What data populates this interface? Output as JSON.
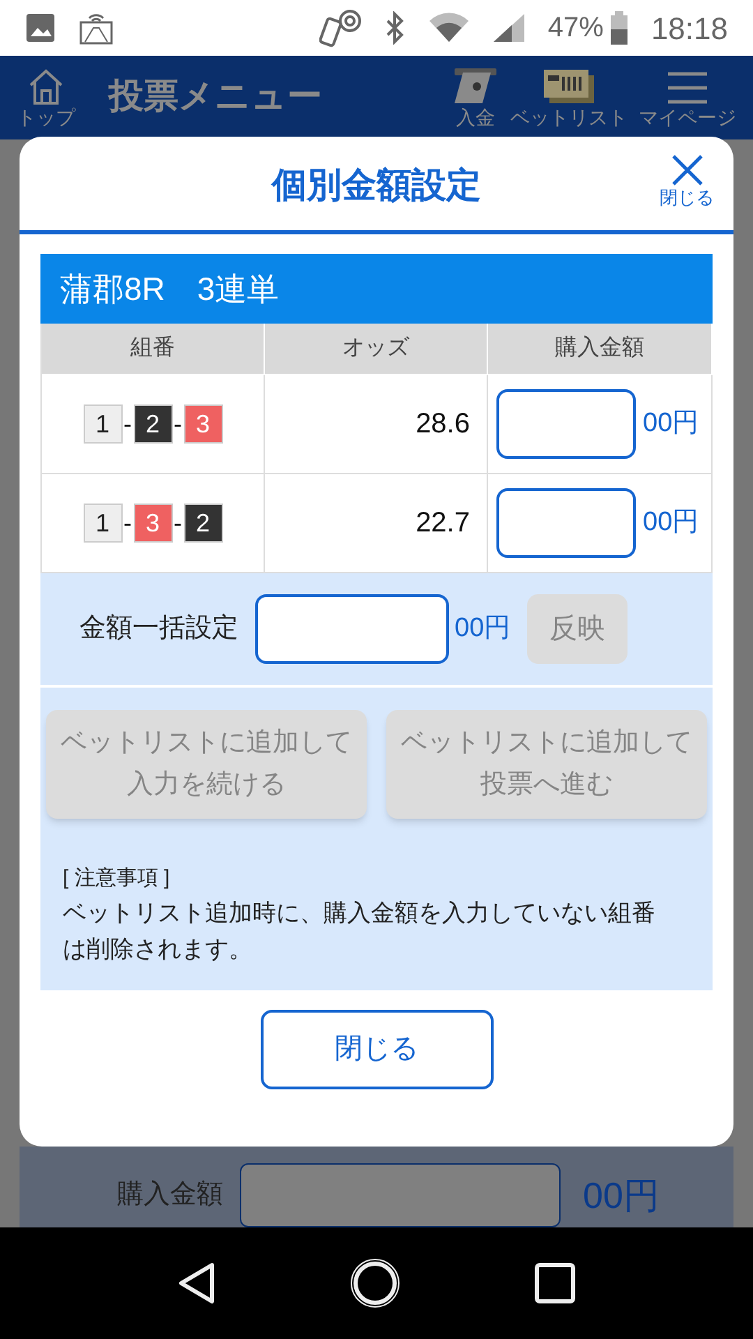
{
  "status_bar": {
    "battery": "47%",
    "time": "18:18"
  },
  "header": {
    "title": "投票メニュー",
    "nav": [
      {
        "kind": "home",
        "label": "トップ"
      },
      {
        "kind": "deposit",
        "label": "入金"
      },
      {
        "kind": "betlist",
        "label": "ベットリスト"
      },
      {
        "kind": "menu",
        "label": "マイページ"
      }
    ]
  },
  "modal": {
    "title": "個別金額設定",
    "close_label": "閉じる",
    "race": "蒲郡8R　3連単",
    "columns": [
      "組番",
      "オッズ",
      "購入金額"
    ],
    "rows": [
      {
        "balls": [
          {
            "number": "1",
            "color": "#eeeeee"
          },
          {
            "number": "2",
            "color": "#333333"
          },
          {
            "number": "3",
            "color": "#ef6161"
          }
        ],
        "separators": [
          "-",
          "-"
        ],
        "odds": "28.6",
        "unit": "00円"
      },
      {
        "balls": [
          {
            "number": "1",
            "color": "#eeeeee"
          },
          {
            "number": "3",
            "color": "#ef6161"
          },
          {
            "number": "2",
            "color": "#333333"
          }
        ],
        "separators": [
          "-",
          "-"
        ],
        "odds": "22.7",
        "unit": "00円"
      }
    ],
    "bulk": {
      "label": "金額一括設定",
      "unit": "00円",
      "button": {
        "label": "反映",
        "disabled": true
      }
    },
    "actions": [
      {
        "label": "ベットリストに追加して入力を続ける",
        "disabled": true
      },
      {
        "label": "ベットリストに追加して投票へ進む",
        "disabled": true
      }
    ],
    "notice": {
      "heading": "[ 注意事項 ]",
      "text": "ベットリスト追加時に、購入金額を入力していない組番は削除されます。"
    },
    "close_button": "閉じる"
  },
  "background_form": {
    "label": "購入金額",
    "unit": "00円"
  }
}
